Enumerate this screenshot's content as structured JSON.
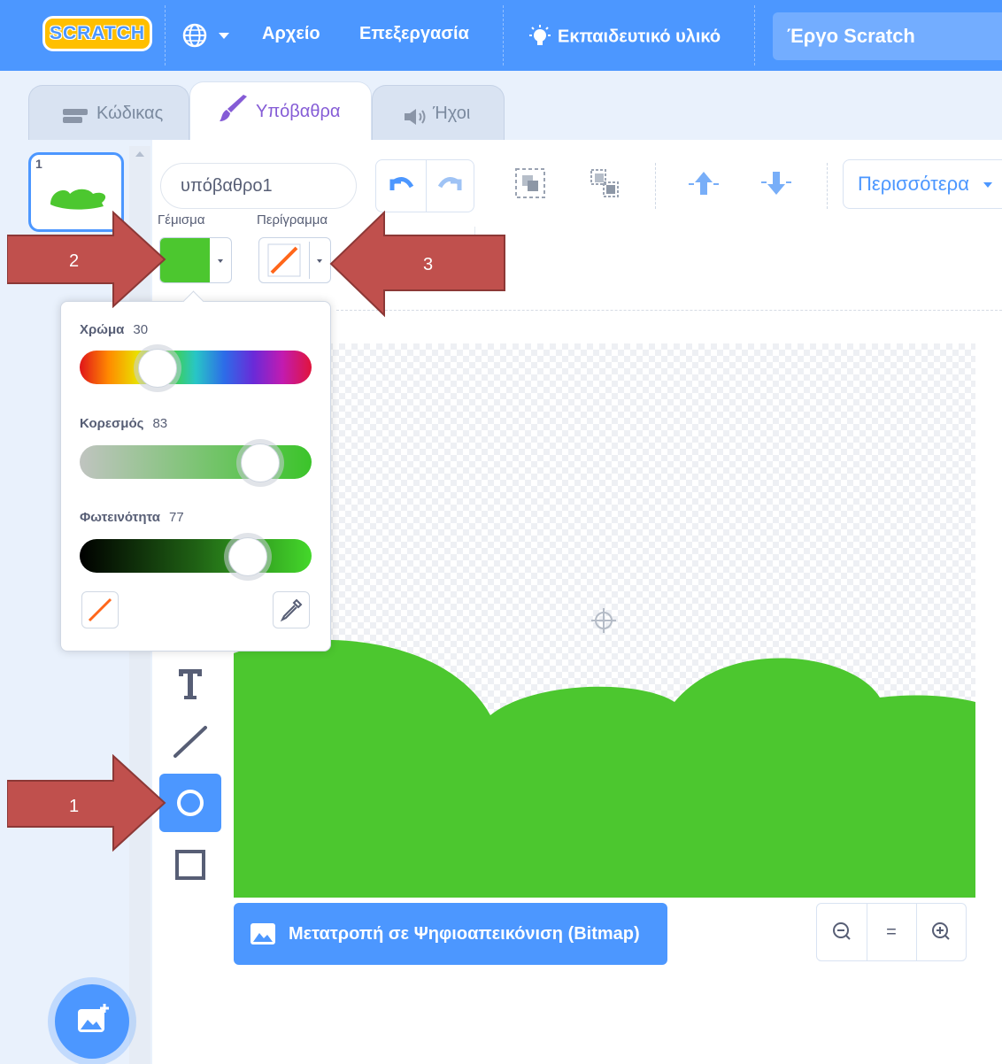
{
  "menubar": {
    "logo": "SCRATCH",
    "file": "Αρχείο",
    "edit": "Επεξεργασία",
    "tutorials": "Εκπαιδευτικό υλικό",
    "project_title": "Έργο Scratch"
  },
  "tabs": [
    {
      "label": "Κώδικας"
    },
    {
      "label": "Υπόβαθρα"
    },
    {
      "label": "Ήχοι"
    }
  ],
  "backdrops": [
    {
      "number": "1"
    }
  ],
  "toolbar": {
    "costume_name": "υπόβαθρο1",
    "more_label": "Περισσότερα",
    "fill_label": "Γέμισμα",
    "outline_label": "Περίγραμμα",
    "fill_color": "#4cc72f"
  },
  "color_picker": {
    "color_label": "Χρώμα",
    "color_value": "30",
    "saturation_label": "Κορεσμός",
    "saturation_value": "83",
    "brightness_label": "Φωτεινότητα",
    "brightness_value": "77"
  },
  "tools": [
    "text-tool",
    "line-tool",
    "circle-tool",
    "rectangle-tool"
  ],
  "canvas": {
    "convert_label": "Μετατροπή σε Ψηφιοαπεικόνιση (Bitmap)",
    "zoom_reset": "="
  },
  "annotations": [
    {
      "number": "1"
    },
    {
      "number": "2"
    },
    {
      "number": "3"
    }
  ],
  "colors": {
    "accent": "#4c97ff",
    "green": "#4cc72f",
    "arrow": "#c0504d",
    "tab_active": "#855cd6"
  }
}
